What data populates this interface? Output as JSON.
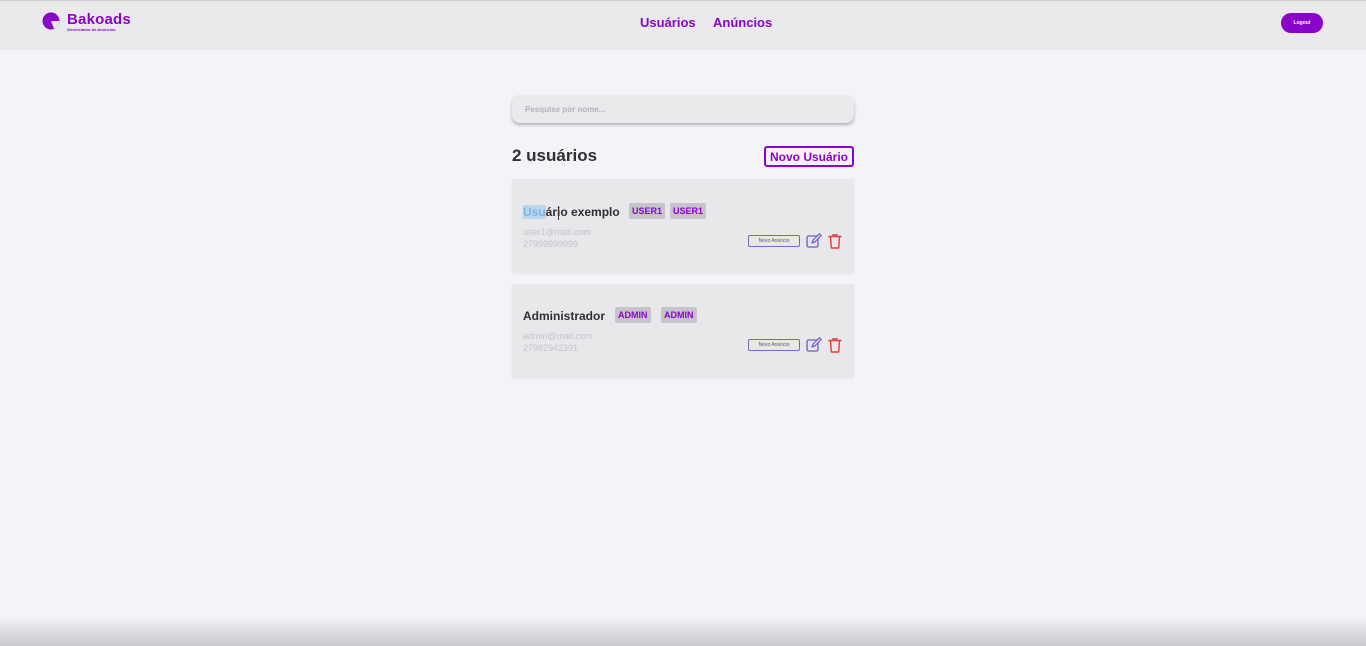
{
  "brand": {
    "name": "Bakoads",
    "tagline": "Gerenciador de Anúncios",
    "color": "#8a05c9"
  },
  "nav": {
    "users": "Usuários",
    "ads": "Anúncios",
    "logout": "Logout"
  },
  "search": {
    "placeholder": "Pesquise por nome...",
    "value": ""
  },
  "list": {
    "count_title": "2 usuários",
    "new_user_label": "Novo Usuário"
  },
  "users": [
    {
      "name_selected": "Usu",
      "name_rest": "ário exemplo",
      "badges": [
        "USER1",
        "USER1"
      ],
      "email": "user1@mail.com",
      "phone": "27999999999",
      "new_ad_label": "Novo Anúncio",
      "edit_icon": "edit-icon",
      "delete_icon": "trash-icon"
    },
    {
      "name": "Administrador",
      "badges": [
        "ADMIN",
        "ADMIN"
      ],
      "email": "admin@mail.com",
      "phone": "27992942391",
      "new_ad_label": "Novo Anúncio",
      "edit_icon": "edit-icon",
      "delete_icon": "trash-icon"
    }
  ],
  "colors": {
    "accent": "#8a05c9",
    "delete": "#e23b3b",
    "edit": "#6a5ad0"
  }
}
